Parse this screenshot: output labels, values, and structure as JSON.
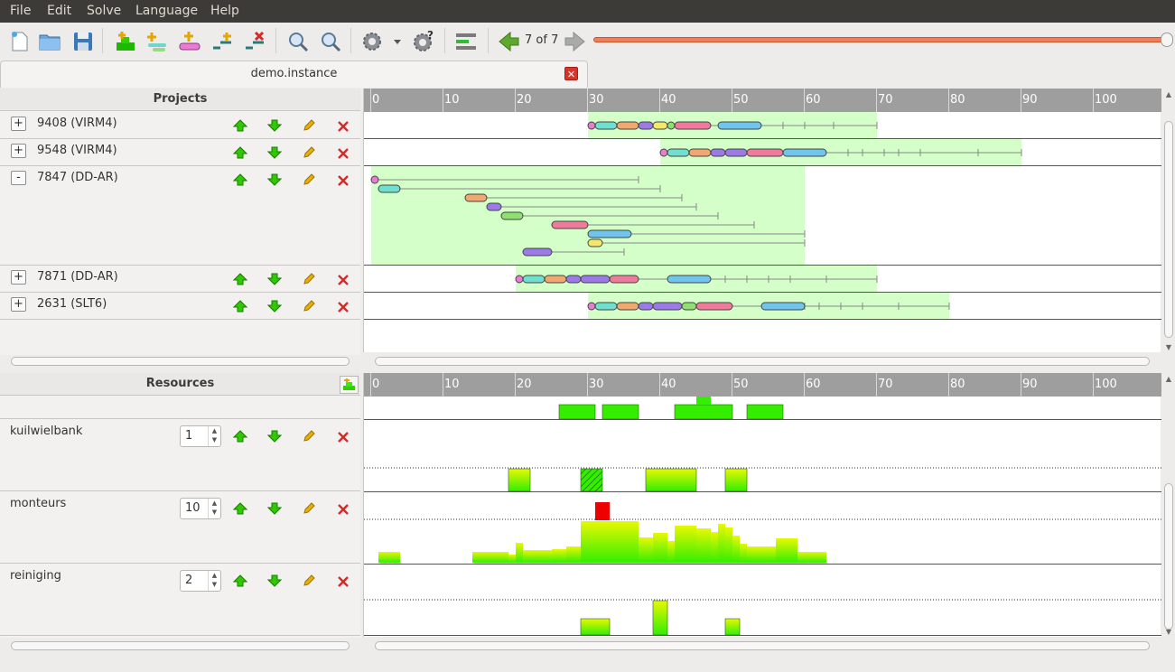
{
  "menu": [
    "File",
    "Edit",
    "Solve",
    "Language",
    "Help"
  ],
  "toolbar": {
    "counter": "7 of 7",
    "icons": [
      "new-file-icon",
      "open-folder-icon",
      "save-icon",
      "add-resource-icon",
      "add-project-icon",
      "add-task-icon",
      "add-link-icon",
      "remove-link-icon",
      "zoom-in-icon",
      "zoom-out-icon",
      "settings-icon",
      "dropdown-icon",
      "help-settings-icon",
      "layout-icon",
      "prev-icon",
      "next-icon"
    ],
    "slider_value": 1.0
  },
  "tab": {
    "title": "demo.instance"
  },
  "projects": {
    "header": "Projects",
    "rows": [
      {
        "expander": "+",
        "label": "9408 (VIRM4)"
      },
      {
        "expander": "+",
        "label": "9548 (VIRM4)"
      },
      {
        "expander": "-",
        "label": "7847 (DD-AR)"
      },
      {
        "expander": "+",
        "label": "7871 (DD-AR)"
      },
      {
        "expander": "+",
        "label": "2631 (SLT6)"
      }
    ]
  },
  "resources": {
    "header": "Resources",
    "rows": [
      {
        "label": "kuilwielbank",
        "capacity": "1"
      },
      {
        "label": "monteurs",
        "capacity": "10"
      },
      {
        "label": "reiniging",
        "capacity": "2"
      }
    ]
  },
  "axis": {
    "ticks": [
      "0",
      "10",
      "20",
      "30",
      "40",
      "50",
      "60",
      "70",
      "80",
      "90",
      "100"
    ]
  },
  "colors": {
    "window_bar": "#f07e5a",
    "bar_green": "#33ee00",
    "bar_yellow": "#e8f800",
    "over_red": "#ee0000",
    "project_bg": "#d4ffc8"
  }
}
